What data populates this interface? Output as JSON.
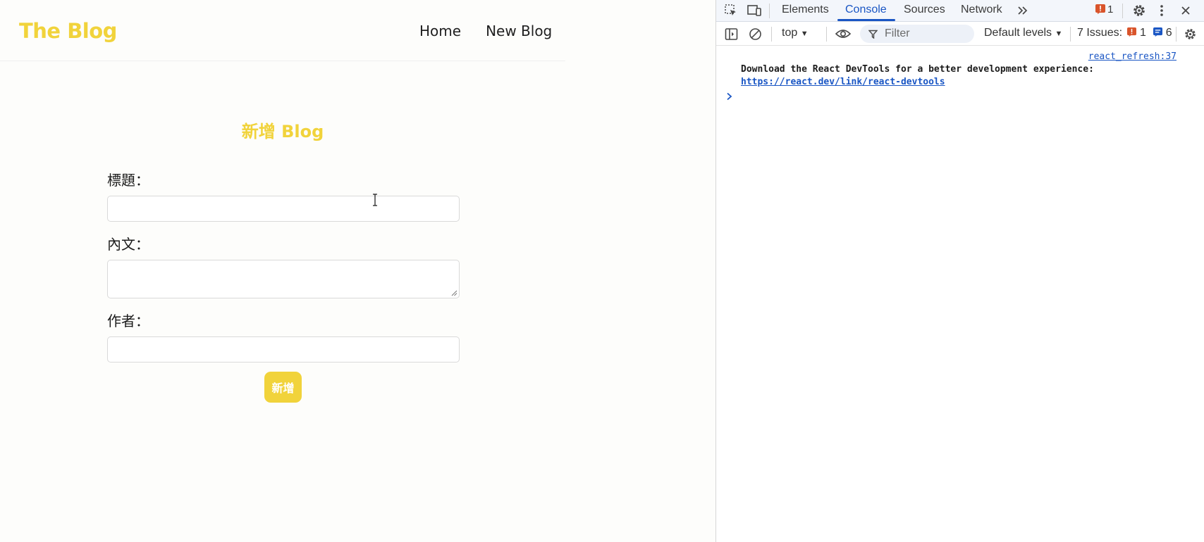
{
  "blog": {
    "brand": "The Blog",
    "nav": [
      {
        "label": "Home"
      },
      {
        "label": "New Blog"
      }
    ],
    "form": {
      "heading": "新增 Blog",
      "title_label": "標題：",
      "title_value": "",
      "body_label": "內文：",
      "body_value": "",
      "author_label": "作者：",
      "author_value": "",
      "submit_label": "新增"
    },
    "colors": {
      "accent": "#f1d33b",
      "text": "#1a1a1a",
      "background": "#fdfdfb"
    }
  },
  "devtools": {
    "tabs": [
      {
        "label": "Elements"
      },
      {
        "label": "Console",
        "active": true
      },
      {
        "label": "Sources"
      },
      {
        "label": "Network"
      }
    ],
    "error_count": "1",
    "toolbar": {
      "context": "top",
      "filter_placeholder": "Filter",
      "levels": "Default levels",
      "issues_label": "7 Issues:",
      "issues_errors": "1",
      "issues_info": "6"
    },
    "console": {
      "source": "react_refresh:37",
      "message": "Download the React DevTools for a better development experience:",
      "link": "https://react.dev/link/react-devtools"
    },
    "colors": {
      "accent": "#1a56c4",
      "error": "#d9542b"
    }
  }
}
